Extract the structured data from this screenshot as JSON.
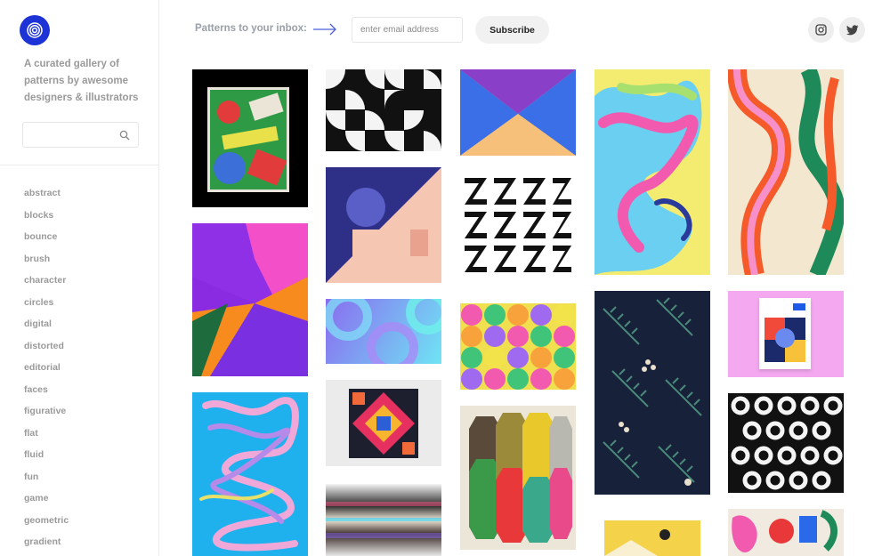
{
  "sidebar": {
    "tagline": "A curated gallery of patterns by awesome designers & illustrators",
    "categories": [
      "abstract",
      "blocks",
      "bounce",
      "brush",
      "character",
      "circles",
      "digital",
      "distorted",
      "editorial",
      "faces",
      "figurative",
      "flat",
      "fluid",
      "fun",
      "game",
      "geometric",
      "gradient"
    ]
  },
  "header": {
    "label": "Patterns to your inbox:",
    "email_placeholder": "enter email address",
    "subscribe_label": "Subscribe"
  },
  "social": [
    "instagram-icon",
    "twitter-icon"
  ],
  "colors": {
    "brand": "#1d33d6",
    "muted_text": "#9a9a9a"
  }
}
